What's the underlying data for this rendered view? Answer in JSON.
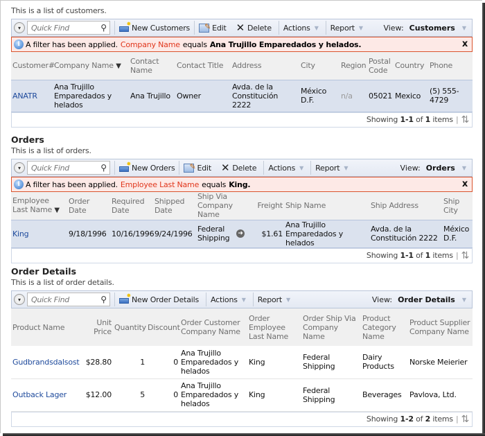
{
  "customers": {
    "description": "This is a list of customers.",
    "toolbar": {
      "quick_find_placeholder": "Quick Find",
      "new_label": "New Customers",
      "edit_label": "Edit",
      "delete_label": "Delete",
      "actions_label": "Actions",
      "report_label": "Report",
      "view_label": "View:",
      "view_value": "Customers"
    },
    "filter": {
      "prefix": "A filter has been applied.",
      "field": "Company Name",
      "operator": "equals",
      "value": "Ana Trujillo Emparedados y helados."
    },
    "columns": [
      "Customer#",
      "Company Name",
      "Contact Name",
      "Contact Title",
      "Address",
      "City",
      "Region",
      "Postal Code",
      "Country",
      "Phone"
    ],
    "rows": [
      {
        "customer_id": "ANATR",
        "company": "Ana Trujillo Emparedados y helados",
        "contact_name": "Ana Trujillo",
        "contact_title": "Owner",
        "address": "Avda. de la Constitución 2222",
        "city": "México D.F.",
        "region": "n/a",
        "postal": "05021",
        "country": "Mexico",
        "phone": "(5) 555-4729"
      }
    ],
    "footer": {
      "showing": "Showing",
      "range": "1-1",
      "of": "of",
      "total": "1",
      "items": "items"
    }
  },
  "orders": {
    "title": "Orders",
    "description": "This is a list of orders.",
    "toolbar": {
      "quick_find_placeholder": "Quick Find",
      "new_label": "New Orders",
      "edit_label": "Edit",
      "delete_label": "Delete",
      "actions_label": "Actions",
      "report_label": "Report",
      "view_label": "View:",
      "view_value": "Orders"
    },
    "filter": {
      "prefix": "A filter has been applied.",
      "field": "Employee Last Name",
      "operator": "equals",
      "value": "King."
    },
    "columns": [
      "Employee Last Name",
      "Order Date",
      "Required Date",
      "Shipped Date",
      "Ship Via Company Name",
      "Freight",
      "Ship Name",
      "Ship Address",
      "Ship City"
    ],
    "rows": [
      {
        "employee": "King",
        "order_date": "9/18/1996",
        "required_date": "10/16/1996",
        "shipped_date": "9/24/1996",
        "ship_via": "Federal Shipping",
        "freight": "$1.61",
        "ship_name": "Ana Trujillo Emparedados y helados",
        "ship_address": "Avda. de la Constitución 2222",
        "ship_city": "México D.F."
      }
    ],
    "footer": {
      "showing": "Showing",
      "range": "1-1",
      "of": "of",
      "total": "1",
      "items": "items"
    }
  },
  "order_details": {
    "title": "Order Details",
    "description": "This is a list of order details.",
    "toolbar": {
      "quick_find_placeholder": "Quick Find",
      "new_label": "New Order Details",
      "actions_label": "Actions",
      "report_label": "Report",
      "view_label": "View:",
      "view_value": "Order Details"
    },
    "columns": [
      "Product Name",
      "Unit Price",
      "Quantity",
      "Discount",
      "Order Customer Company Name",
      "Order Employee Last Name",
      "Order Ship Via Company Name",
      "Product Category Name",
      "Product Supplier Company Name"
    ],
    "rows": [
      {
        "product": "Gudbrandsdalsost",
        "unit_price": "$28.80",
        "quantity": "1",
        "discount": "0",
        "customer": "Ana Trujillo Emparedados y helados",
        "employee": "King",
        "ship_via": "Federal Shipping",
        "category": "Dairy Products",
        "supplier": "Norske Meierier"
      },
      {
        "product": "Outback Lager",
        "unit_price": "$12.00",
        "quantity": "5",
        "discount": "0",
        "customer": "Ana Trujillo Emparedados y helados",
        "employee": "King",
        "ship_via": "Federal Shipping",
        "category": "Beverages",
        "supplier": "Pavlova, Ltd."
      }
    ],
    "footer": {
      "showing": "Showing",
      "range": "1-2",
      "of": "of",
      "total": "2",
      "items": "items"
    }
  }
}
